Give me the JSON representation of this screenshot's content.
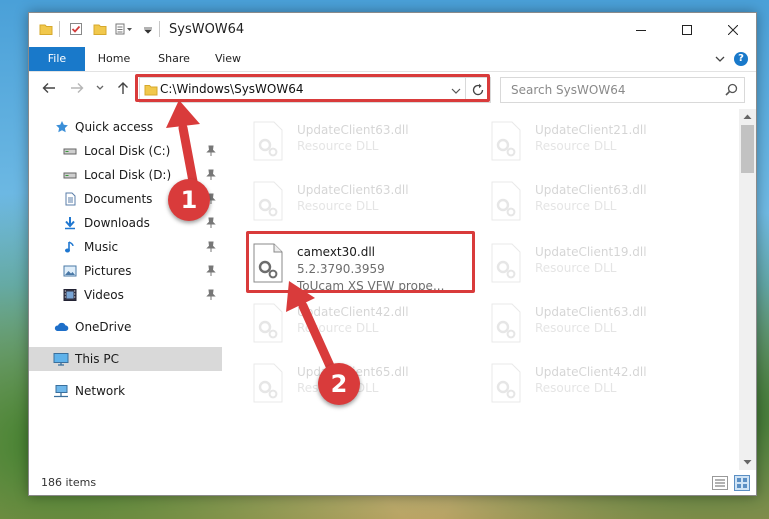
{
  "window": {
    "title": "SysWOW64"
  },
  "ribbon": {
    "tabs": [
      "File",
      "Home",
      "Share",
      "View"
    ]
  },
  "address": {
    "path": "C:\\Windows\\SysWOW64"
  },
  "search": {
    "placeholder": "Search SysWOW64"
  },
  "nav": {
    "items": [
      {
        "label": "Quick access",
        "icon": "star-icon"
      },
      {
        "label": "Local Disk (C:)",
        "icon": "drive-icon",
        "pinned": true
      },
      {
        "label": "Local Disk (D:)",
        "icon": "drive-icon",
        "pinned": true
      },
      {
        "label": "Documents",
        "icon": "documents-icon",
        "pinned": true
      },
      {
        "label": "Downloads",
        "icon": "download-icon",
        "pinned": true
      },
      {
        "label": "Music",
        "icon": "music-icon",
        "pinned": true
      },
      {
        "label": "Pictures",
        "icon": "pictures-icon",
        "pinned": true
      },
      {
        "label": "Videos",
        "icon": "videos-icon",
        "pinned": true
      },
      {
        "label": "OneDrive",
        "icon": "cloud-icon"
      },
      {
        "label": "This PC",
        "icon": "computer-icon",
        "selected": true
      },
      {
        "label": "Network",
        "icon": "network-icon"
      }
    ]
  },
  "files": {
    "left": [
      {
        "name": "UpdateClient63.dll",
        "type": "Resource DLL"
      },
      {
        "name": "UpdateClient63.dll",
        "type": "Resource DLL"
      },
      {
        "name": "camext30.dll",
        "version": "5.2.3790.3959",
        "description": "ToUcam XS VFW prope..."
      },
      {
        "name": "UpdateClient42.dll",
        "type": "Resource DLL"
      },
      {
        "name": "UpdateClient65.dll",
        "type": "Resource DLL"
      }
    ],
    "right": [
      {
        "name": "UpdateClient21.dll",
        "type": "Resource DLL"
      },
      {
        "name": "UpdateClient63.dll",
        "type": "Resource DLL"
      },
      {
        "name": "UpdateClient19.dll",
        "type": "Resource DLL"
      },
      {
        "name": "UpdateClient63.dll",
        "type": "Resource DLL"
      },
      {
        "name": "UpdateClient42.dll",
        "type": "Resource DLL"
      }
    ]
  },
  "status": {
    "item_count": "186 items"
  },
  "annotations": {
    "step1": "1",
    "step2": "2",
    "color": "#d93b3b"
  }
}
